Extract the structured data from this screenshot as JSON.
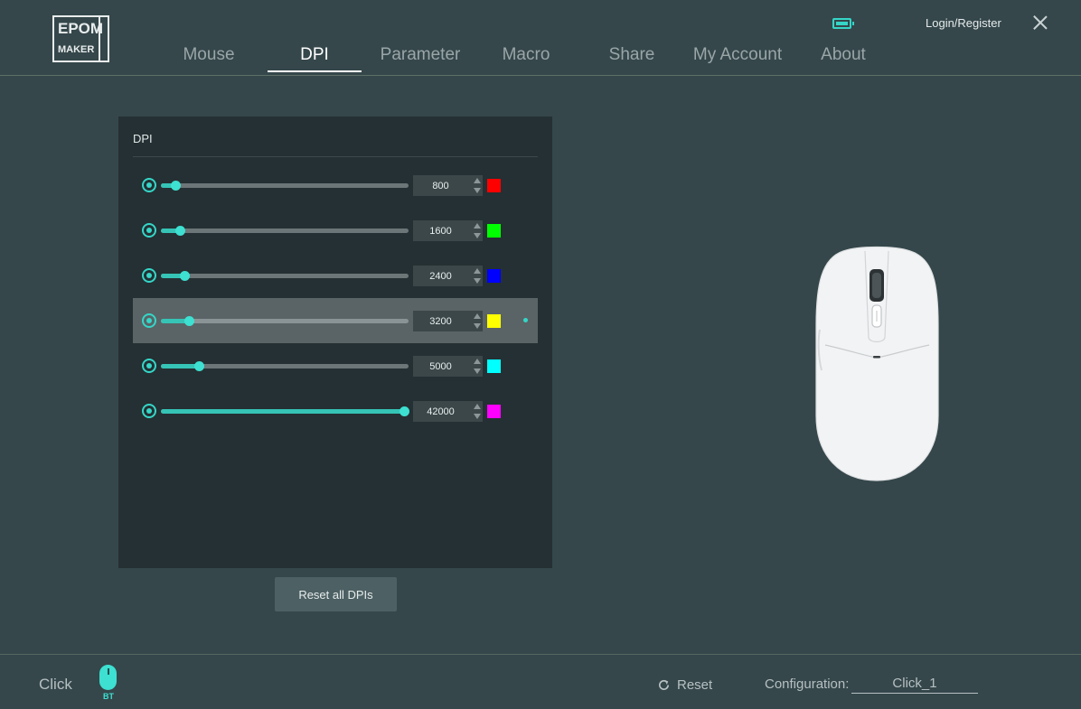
{
  "header": {
    "logo_line1": "EPOM",
    "logo_line2": "MAKER",
    "nav": [
      {
        "label": "Mouse",
        "active": false
      },
      {
        "label": "DPI",
        "active": true
      },
      {
        "label": "Parameter",
        "active": false
      },
      {
        "label": "Macro",
        "active": false
      },
      {
        "label": "Share",
        "active": false
      },
      {
        "label": "My Account",
        "active": false
      },
      {
        "label": "About",
        "active": false
      }
    ],
    "login_label": "Login/Register",
    "battery_color": "#35d6c8"
  },
  "dpi_panel": {
    "title": "DPI",
    "max_dpi": 42000,
    "rows": [
      {
        "value": "800",
        "level": 0.019,
        "color": "#ff0000",
        "selected": false
      },
      {
        "value": "1600",
        "level": 0.038,
        "color": "#00ff00",
        "selected": false
      },
      {
        "value": "2400",
        "level": 0.057,
        "color": "#0000ff",
        "selected": false
      },
      {
        "value": "3200",
        "level": 0.076,
        "color": "#ffff00",
        "selected": true
      },
      {
        "value": "5000",
        "level": 0.119,
        "color": "#00ffff",
        "selected": false
      },
      {
        "value": "42000",
        "level": 1.0,
        "color": "#ff00ff",
        "selected": false
      }
    ],
    "reset_all_label": "Reset all DPIs"
  },
  "footer": {
    "device_name": "Click",
    "device_mode": "BT",
    "reset_label": "Reset",
    "config_label": "Configuration:",
    "config_value": "Click_1"
  },
  "colors": {
    "accent": "#35d6c8",
    "background": "#35474b",
    "panel": "#243033"
  }
}
